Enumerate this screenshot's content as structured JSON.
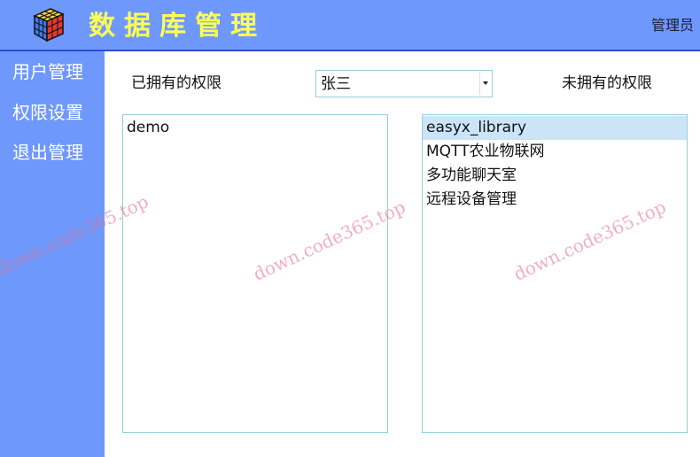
{
  "header": {
    "title": "数据库管理",
    "user_role": "管理员",
    "logo_icon": "rubik-cube-icon"
  },
  "sidebar": {
    "items": [
      {
        "label": "用户管理"
      },
      {
        "label": "权限设置"
      },
      {
        "label": "退出管理"
      }
    ]
  },
  "permissions": {
    "owned_label": "已拥有的权限",
    "unowned_label": "未拥有的权限",
    "user_select": {
      "value": "张三"
    },
    "owned": [
      "demo"
    ],
    "unowned": [
      "easyx_library",
      "MQTT农业物联网",
      "多功能聊天室",
      "远程设备管理"
    ],
    "selected_unowned": "easyx_library"
  },
  "watermark": {
    "text": "down.code365.top"
  },
  "colors": {
    "header_bg": "#6e98fb",
    "title_yellow": "#ffff55",
    "selection_bg": "#cce4f7",
    "list_border": "#8fd0d8"
  }
}
